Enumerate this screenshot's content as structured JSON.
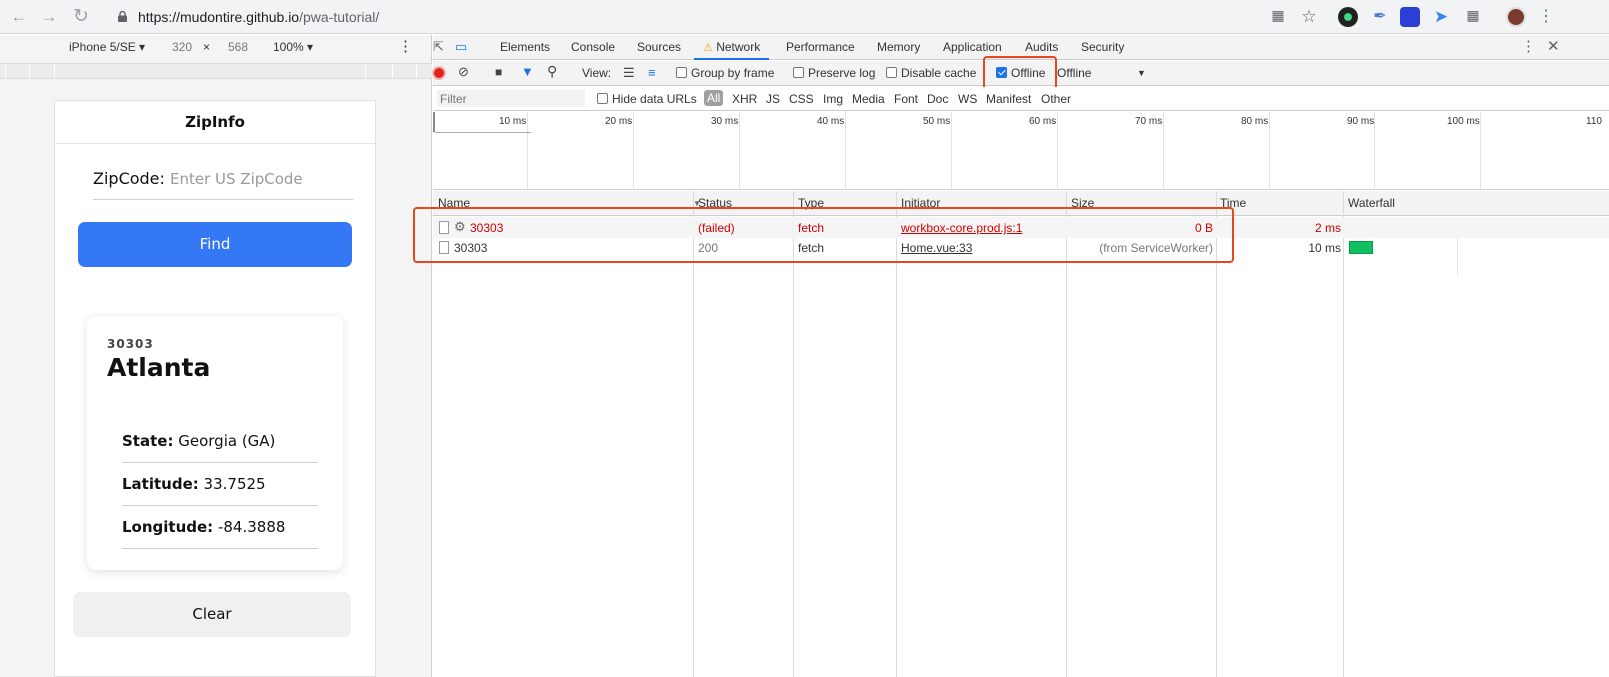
{
  "browser": {
    "url_host": "https://mudontire.github.io",
    "url_path": "/pwa-tutorial/"
  },
  "device_toolbar": {
    "device": "iPhone 5/SE ▾",
    "width": "320",
    "times": "×",
    "height": "568",
    "zoom": "100% ▾"
  },
  "app": {
    "title": "ZipInfo",
    "zip_label": "ZipCode:",
    "zip_placeholder": "Enter US ZipCode",
    "find_label": "Find",
    "clear_label": "Clear",
    "card": {
      "zip": "30303",
      "city": "Atlanta",
      "rows": [
        {
          "label": "State:",
          "value": "Georgia (GA)"
        },
        {
          "label": "Latitude:",
          "value": "33.7525"
        },
        {
          "label": "Longitude:",
          "value": "-84.3888"
        }
      ]
    }
  },
  "devtools": {
    "tabs": [
      "Elements",
      "Console",
      "Sources",
      "Network",
      "Performance",
      "Memory",
      "Application",
      "Audits",
      "Security"
    ],
    "active_tab": "Network",
    "toolbar": {
      "view_label": "View:",
      "group_by_frame": "Group by frame",
      "preserve_log": "Preserve log",
      "disable_cache": "Disable cache",
      "offline": "Offline",
      "throttle": "Offline"
    },
    "filter_placeholder": "Filter",
    "hide_data_urls": "Hide data URLs",
    "filter_types": [
      "All",
      "XHR",
      "JS",
      "CSS",
      "Img",
      "Media",
      "Font",
      "Doc",
      "WS",
      "Manifest",
      "Other"
    ],
    "timeline_ticks": [
      "10 ms",
      "20 ms",
      "30 ms",
      "40 ms",
      "50 ms",
      "60 ms",
      "70 ms",
      "80 ms",
      "90 ms",
      "100 ms",
      "110"
    ],
    "columns": [
      "Name",
      "Status",
      "Type",
      "Initiator",
      "Size",
      "Time",
      "Waterfall"
    ],
    "requests": [
      {
        "name": "30303",
        "status": "(failed)",
        "type": "fetch",
        "initiator": "workbox-core.prod.js:1",
        "size": "0 B",
        "time": "2 ms"
      },
      {
        "name": "30303",
        "status": "200",
        "type": "fetch",
        "initiator": "Home.vue:33",
        "size": "(from ServiceWorker)",
        "time": "10 ms",
        "waterfall_fraction": 0.02
      }
    ]
  },
  "colors": {
    "accent": "#1a73e8",
    "find_button": "#3478f6",
    "error": "#d10000",
    "highlight": "#e8461c",
    "waterfall": "#10c060"
  }
}
